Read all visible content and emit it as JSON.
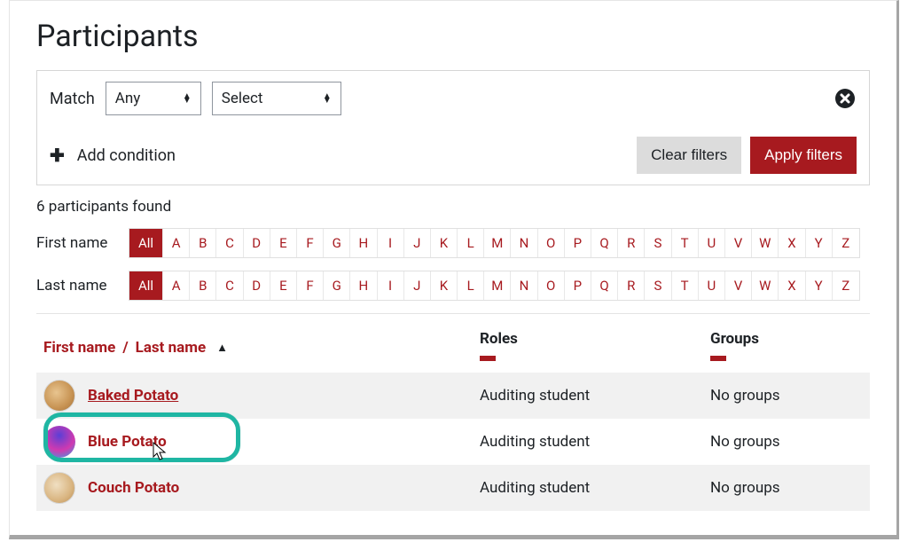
{
  "title": "Participants",
  "filter": {
    "match_label": "Match",
    "any_label": "Any",
    "select_label": "Select",
    "add_condition_label": "Add condition",
    "clear_label": "Clear filters",
    "apply_label": "Apply filters"
  },
  "found_text": "6 participants found",
  "alpha": {
    "firstname_label": "First name",
    "lastname_label": "Last name",
    "all_label": "All",
    "letters": [
      "A",
      "B",
      "C",
      "D",
      "E",
      "F",
      "G",
      "H",
      "I",
      "J",
      "K",
      "L",
      "M",
      "N",
      "O",
      "P",
      "Q",
      "R",
      "S",
      "T",
      "U",
      "V",
      "W",
      "X",
      "Y",
      "Z"
    ]
  },
  "table": {
    "name_first": "First name",
    "name_last": "Last name",
    "roles": "Roles",
    "groups": "Groups"
  },
  "rows": [
    {
      "name": "Baked Potato",
      "role": "Auditing student",
      "group": "No groups",
      "shaded": true,
      "underline": true,
      "avatar": "a0"
    },
    {
      "name": "Blue Potato",
      "role": "Auditing student",
      "group": "No groups",
      "shaded": false,
      "underline": false,
      "avatar": "a1"
    },
    {
      "name": "Couch Potato",
      "role": "Auditing student",
      "group": "No groups",
      "shaded": true,
      "underline": false,
      "avatar": "a2"
    }
  ]
}
